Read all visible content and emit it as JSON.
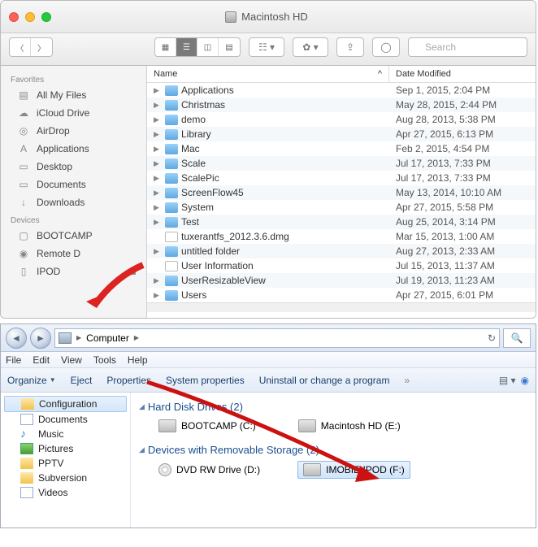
{
  "mac": {
    "title": "Macintosh HD",
    "search_placeholder": "Search",
    "sidebar": {
      "favorites_label": "Favorites",
      "devices_label": "Devices",
      "favorites": [
        {
          "label": "All My Files",
          "icon": "all-files"
        },
        {
          "label": "iCloud Drive",
          "icon": "cloud"
        },
        {
          "label": "AirDrop",
          "icon": "airdrop"
        },
        {
          "label": "Applications",
          "icon": "apps"
        },
        {
          "label": "Desktop",
          "icon": "desktop"
        },
        {
          "label": "Documents",
          "icon": "docs"
        },
        {
          "label": "Downloads",
          "icon": "downloads"
        }
      ],
      "devices": [
        {
          "label": "BOOTCAMP",
          "icon": "hd"
        },
        {
          "label": "Remote D",
          "icon": "disc"
        },
        {
          "label": "IPOD",
          "icon": "ipod",
          "ejectable": true
        }
      ]
    },
    "columns": {
      "name": "Name",
      "sort": "^",
      "date": "Date Modified"
    },
    "files": [
      {
        "name": "Applications",
        "type": "folder",
        "date": "Sep 1, 2015, 2:04 PM"
      },
      {
        "name": "Christmas",
        "type": "folder",
        "date": "May 28, 2015, 2:44 PM"
      },
      {
        "name": "demo",
        "type": "folder",
        "date": "Aug 28, 2013, 5:38 PM"
      },
      {
        "name": "Library",
        "type": "folder",
        "date": "Apr 27, 2015, 6:13 PM"
      },
      {
        "name": "Mac",
        "type": "folder",
        "date": "Feb 2, 2015, 4:54 PM"
      },
      {
        "name": "Scale",
        "type": "folder",
        "date": "Jul 17, 2013, 7:33 PM"
      },
      {
        "name": "ScalePic",
        "type": "folder",
        "date": "Jul 17, 2013, 7:33 PM"
      },
      {
        "name": "ScreenFlow45",
        "type": "folder",
        "date": "May 13, 2014, 10:10 AM"
      },
      {
        "name": "System",
        "type": "folder",
        "date": "Apr 27, 2015, 5:58 PM"
      },
      {
        "name": "Test",
        "type": "folder",
        "date": "Aug 25, 2014, 3:14 PM"
      },
      {
        "name": "tuxerantfs_2012.3.6.dmg",
        "type": "dmg",
        "date": "Mar 15, 2013, 1:00 AM"
      },
      {
        "name": "untitled folder",
        "type": "folder",
        "date": "Aug 27, 2013, 2:33 AM"
      },
      {
        "name": "User Information",
        "type": "txt",
        "date": "Jul 15, 2013, 11:37 AM"
      },
      {
        "name": "UserResizableView",
        "type": "folder",
        "date": "Jul 19, 2013, 11:23 AM"
      },
      {
        "name": "Users",
        "type": "folder",
        "date": "Apr 27, 2015, 6:01 PM"
      }
    ]
  },
  "win": {
    "breadcrumb": "Computer",
    "menus": [
      "File",
      "Edit",
      "View",
      "Tools",
      "Help"
    ],
    "commands": {
      "organize": "Organize",
      "eject": "Eject",
      "properties": "Properties",
      "sysprops": "System properties",
      "uninstall": "Uninstall or change a program"
    },
    "tree": [
      {
        "label": "Configuration",
        "icon": "fold2",
        "sel": true
      },
      {
        "label": "Documents",
        "icon": "doc"
      },
      {
        "label": "Music",
        "icon": "mus"
      },
      {
        "label": "Pictures",
        "icon": "pic"
      },
      {
        "label": "PPTV",
        "icon": "fold2"
      },
      {
        "label": "Subversion",
        "icon": "fold2"
      },
      {
        "label": "Videos",
        "icon": "vid"
      }
    ],
    "groups": [
      {
        "title": "Hard Disk Drives (2)",
        "drives": [
          {
            "label": "BOOTCAMP (C:)",
            "icon": "hd"
          },
          {
            "label": "Macintosh HD (E:)",
            "icon": "hd"
          }
        ]
      },
      {
        "title": "Devices with Removable Storage (2)",
        "drives": [
          {
            "label": "DVD RW Drive (D:)",
            "icon": "dvd"
          },
          {
            "label": "IMOBIE IPOD (F:)",
            "icon": "hd",
            "sel": true
          }
        ]
      }
    ]
  }
}
